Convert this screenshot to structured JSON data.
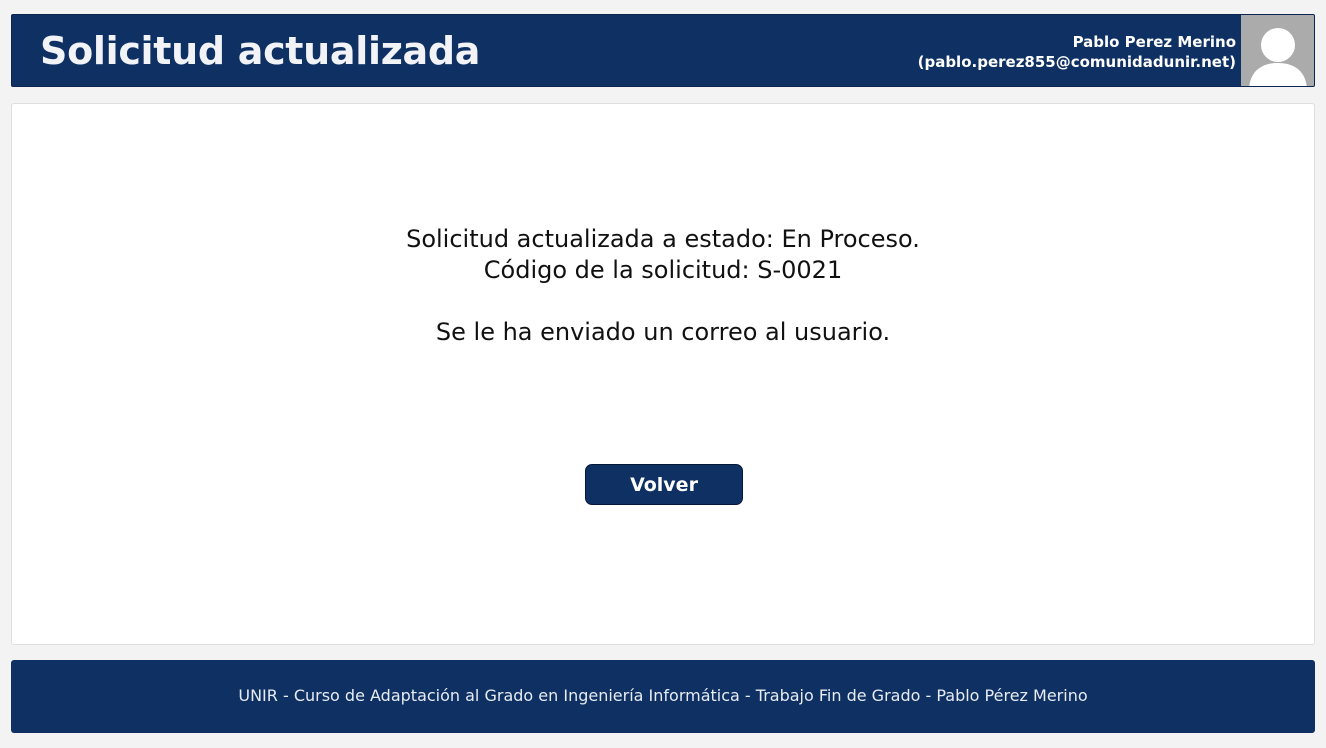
{
  "header": {
    "title": "Solicitud actualizada",
    "user_name": "Pablo Perez Merino",
    "user_email": "(pablo.perez855@comunidadunir.net)",
    "avatar_icon": "user-silhouette-icon"
  },
  "main": {
    "status_message": "Solicitud actualizada a estado: En Proceso.",
    "code_message": "Código de la solicitud: S-0021",
    "email_message": "Se le ha enviado un correo al usuario.",
    "back_button_label": "Volver"
  },
  "footer": {
    "text": "UNIR - Curso de Adaptación al Grado en Ingeniería Informática - Trabajo Fin de Grado - Pablo Pérez Merino"
  },
  "colors": {
    "primary": "#0f3063",
    "background": "#f3f3f4",
    "card": "#ffffff",
    "avatar_bg": "#ababab"
  }
}
